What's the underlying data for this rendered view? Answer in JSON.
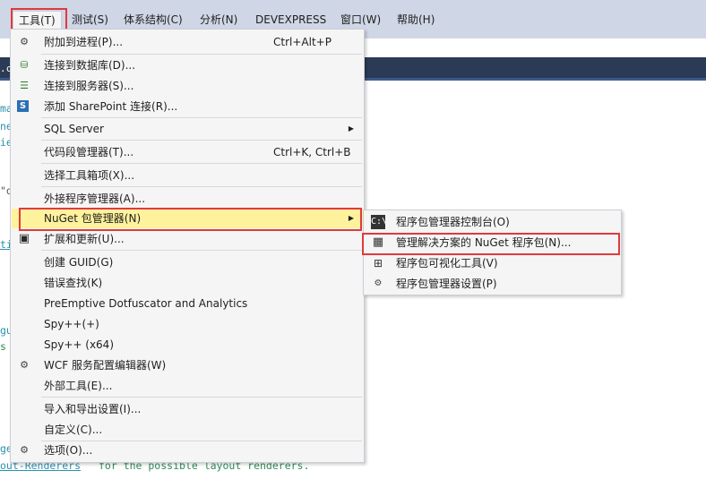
{
  "menubar": {
    "items": [
      {
        "label": "工具(T)"
      },
      {
        "label": "测试(S)"
      },
      {
        "label": "体系结构(C)"
      },
      {
        "label": "分析(N)"
      },
      {
        "label": "DEVEXPRESS"
      },
      {
        "label": "窗口(W)"
      },
      {
        "label": "帮助(H)"
      }
    ]
  },
  "tab": {
    "label": ".cs"
  },
  "editor": {
    "fragments": [
      "ma",
      "ne",
      "ie",
      "\"o",
      "ti",
      "gu",
      "s",
      "ge",
      "out-Renderers",
      "for the possible layout renderers."
    ]
  },
  "tools_menu": {
    "items": [
      {
        "label": "附加到进程(P)...",
        "shortcut": "Ctrl+Alt+P",
        "icon": "attach-process-icon"
      },
      {
        "label": "连接到数据库(D)...",
        "shortcut": "",
        "icon": "connect-database-icon"
      },
      {
        "label": "连接到服务器(S)...",
        "shortcut": "",
        "icon": "connect-server-icon"
      },
      {
        "label": "添加 SharePoint 连接(R)...",
        "shortcut": "",
        "icon": "sharepoint-icon"
      },
      {
        "label": "SQL Server",
        "shortcut": "",
        "icon": ""
      },
      {
        "label": "代码段管理器(T)...",
        "shortcut": "Ctrl+K, Ctrl+B",
        "icon": ""
      },
      {
        "label": "选择工具箱项(X)...",
        "shortcut": "",
        "icon": ""
      },
      {
        "label": "外接程序管理器(A)...",
        "shortcut": "",
        "icon": ""
      },
      {
        "label": "NuGet 包管理器(N)",
        "shortcut": "",
        "icon": ""
      },
      {
        "label": "扩展和更新(U)...",
        "shortcut": "",
        "icon": "extensions-icon"
      },
      {
        "label": "创建 GUID(G)",
        "shortcut": "",
        "icon": ""
      },
      {
        "label": "错误查找(K)",
        "shortcut": "",
        "icon": ""
      },
      {
        "label": "PreEmptive Dotfuscator and Analytics",
        "shortcut": "",
        "icon": ""
      },
      {
        "label": "Spy++(+)",
        "shortcut": "",
        "icon": ""
      },
      {
        "label": "Spy++ (x64)",
        "shortcut": "",
        "icon": ""
      },
      {
        "label": "WCF 服务配置编辑器(W)",
        "shortcut": "",
        "icon": "wcf-config-icon"
      },
      {
        "label": "外部工具(E)...",
        "shortcut": "",
        "icon": ""
      },
      {
        "label": "导入和导出设置(I)...",
        "shortcut": "",
        "icon": ""
      },
      {
        "label": "自定义(C)...",
        "shortcut": "",
        "icon": ""
      },
      {
        "label": "选项(O)...",
        "shortcut": "",
        "icon": "gear-icon"
      }
    ]
  },
  "nuget_submenu": {
    "items": [
      {
        "label": "程序包管理器控制台(O)",
        "icon": "console-icon",
        "glyph": "C:\\"
      },
      {
        "label": "管理解决方案的 NuGet 程序包(N)...",
        "icon": "package-icon"
      },
      {
        "label": "程序包可视化工具(V)",
        "icon": "hierarchy-icon"
      },
      {
        "label": "程序包管理器设置(P)",
        "icon": "gear-icon"
      }
    ]
  }
}
